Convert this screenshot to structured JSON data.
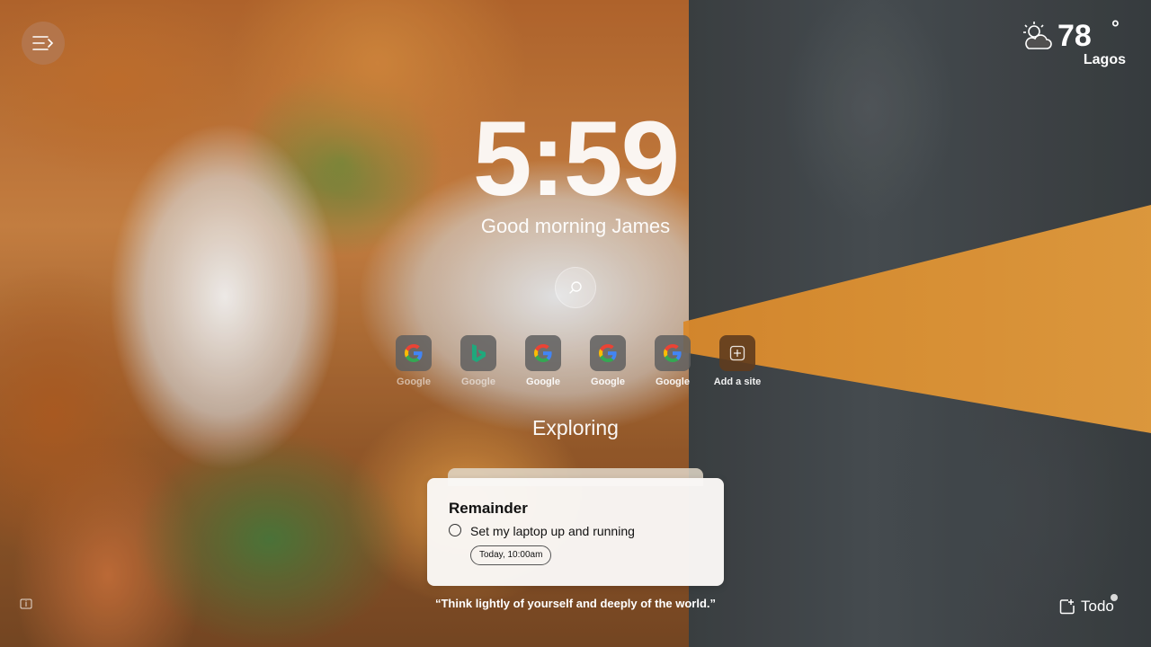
{
  "menu": {
    "icon": "menu-icon"
  },
  "weather": {
    "icon": "partly-cloudy-icon",
    "temperature": "78",
    "degree_symbol": "°",
    "city": "Lagos"
  },
  "clock": {
    "time": "5:59"
  },
  "greeting": {
    "text": "Good morning James"
  },
  "search": {
    "icon": "search-icon"
  },
  "shortcuts": [
    {
      "label": "Google",
      "icon": "google-icon"
    },
    {
      "label": "Google",
      "icon": "bing-icon"
    },
    {
      "label": "Google",
      "icon": "google-icon"
    },
    {
      "label": "Google",
      "icon": "google-icon"
    },
    {
      "label": "Google",
      "icon": "google-icon"
    },
    {
      "label": "Add a site",
      "icon": "add-site-icon"
    }
  ],
  "mantra": {
    "text": "Exploring"
  },
  "reminder": {
    "title": "Remainder",
    "task": "Set my laptop up and running",
    "due": "Today, 10:00am"
  },
  "quote": {
    "text": "“Think lightly of yourself and deeply of the world.”"
  },
  "todo": {
    "label": "Todo",
    "icon": "todo-icon"
  },
  "colors": {
    "road_stripe": "#f0a23c",
    "card_bg": "#faf8f6",
    "menu_bg": "#b47850"
  }
}
